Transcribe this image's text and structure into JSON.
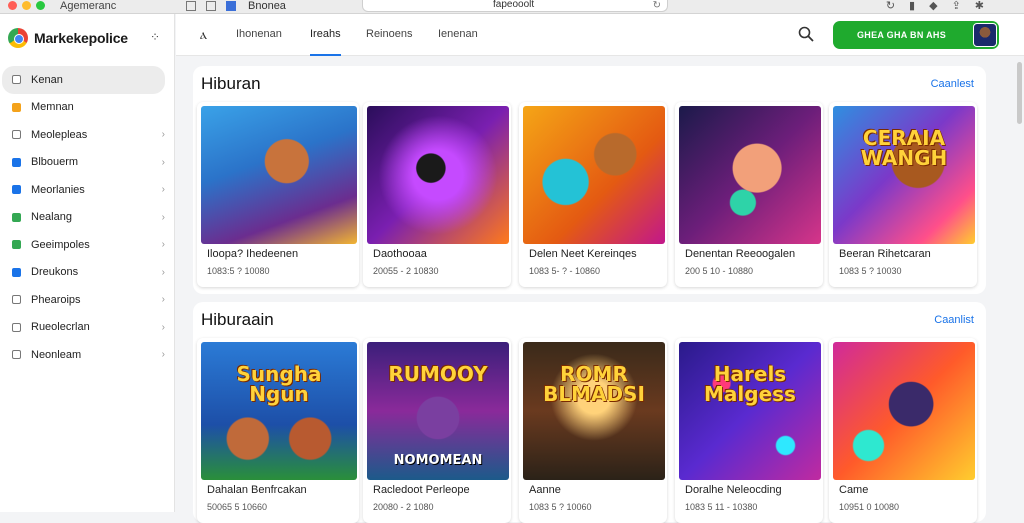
{
  "window": {
    "title": "Agemeranc",
    "tab_label": "Bnonea",
    "url": "fapeooolt"
  },
  "sidebar": {
    "brand": "Markekepolice",
    "items": [
      {
        "label": "Kenan",
        "color": "#ffffff",
        "active": true
      },
      {
        "label": "Memnan",
        "color": "#f4a21b"
      },
      {
        "label": "Meolepleas",
        "color": "#ffffff"
      },
      {
        "label": "Blbouerm",
        "color": "#1a73e8"
      },
      {
        "label": "Meorlanies",
        "color": "#1a73e8"
      },
      {
        "label": "Nealang",
        "color": "#34a853"
      },
      {
        "label": "Geeimpoles",
        "color": "#34a853"
      },
      {
        "label": "Dreukons",
        "color": "#1a73e8"
      },
      {
        "label": "Phearoips",
        "color": "#ffffff"
      },
      {
        "label": "Rueolecrlan",
        "color": "#ffffff"
      },
      {
        "label": "Neonleam",
        "color": "#ffffff"
      }
    ]
  },
  "header": {
    "tabs": [
      {
        "label": "Ihonenan"
      },
      {
        "label": "Ireahs",
        "active": true
      },
      {
        "label": "Reinoens"
      },
      {
        "label": "Ienenan"
      }
    ],
    "cta_label": "GHEA GHA BN AHS"
  },
  "sections": [
    {
      "title": "Hiburan",
      "link": "Caanlest",
      "cards": [
        {
          "title": "Iloopa?  Ihedeenen",
          "meta": "1083:5  ?  10080"
        },
        {
          "title": "Daothooaa",
          "meta": "20055 - 2 10830"
        },
        {
          "title": "Delen Neet  Kereinqes",
          "meta": "1083 5- ? - 10860"
        },
        {
          "title": "Denentan Reeoogalen",
          "meta": "200 5  10 - 10880"
        },
        {
          "title": "Beeran Rihetcaran",
          "meta": "1083 5 ? 10030"
        }
      ]
    },
    {
      "title": "Hiburaain",
      "link": "Caanlist",
      "cards": [
        {
          "title": "Dahalan  Benfrcakan",
          "meta": "50065 5  10660"
        },
        {
          "title": "Racledoot  Perleope",
          "meta": "20080  - 2 1080"
        },
        {
          "title": "Aanne",
          "meta": "1083 5 ? 10060"
        },
        {
          "title": "Doralhe  Neleocding",
          "meta": "1083 5 11 - 10380"
        },
        {
          "title": "Came",
          "meta": "10951 0 10080"
        }
      ],
      "art_text": [
        "Sungha Ngun",
        "RUMOOY",
        "ROMR BLMADSI",
        "Harels Malgess",
        ""
      ]
    }
  ],
  "art_texts_row1": [
    "",
    "",
    "",
    "",
    "CERAIA WANGH"
  ],
  "art_subtext": "NOMOMEAN"
}
